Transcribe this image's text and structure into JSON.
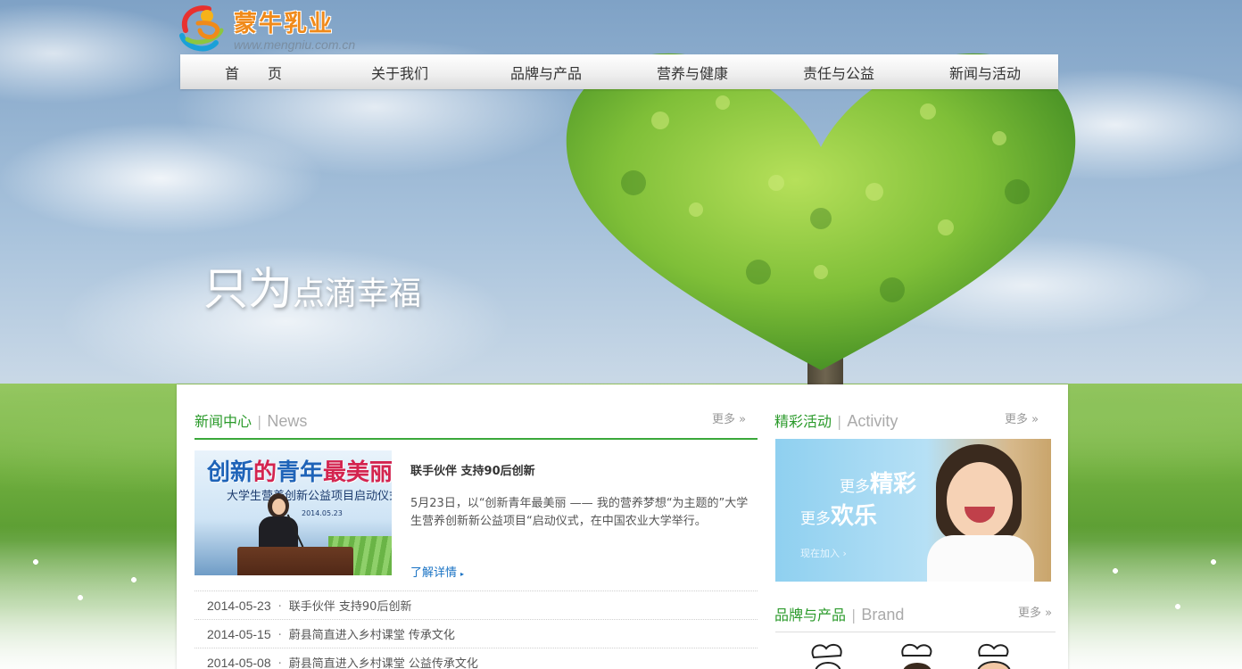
{
  "logo": {
    "name": "蒙牛乳业",
    "url": "www.mengniu.com.cn"
  },
  "nav": {
    "items": [
      "首　　页",
      "关于我们",
      "品牌与产品",
      "营养与健康",
      "责任与公益",
      "新闻与活动"
    ]
  },
  "hero": {
    "slogan_big": "只为",
    "slogan_small": "点滴幸福"
  },
  "news": {
    "title_cn": "新闻中心",
    "separator": "|",
    "title_en": "News",
    "more": "更多 »",
    "photo": {
      "title_blue1": "创新",
      "title_red1": "的",
      "title_blue2": "青年",
      "title_red2": "最美丽",
      "subtitle": "大学生营养创新公益项目启动仪式",
      "date": "2014.05.23"
    },
    "featured": {
      "title": "联手伙伴 支持90后创新",
      "description": "5月23日，以“创新青年最美丽 —— 我的营养梦想“为主题的”大学生营养创新新公益项目“启动仪式，在中国农业大学举行。",
      "more": "了解详情",
      "more_arrow": "▸"
    },
    "list": [
      {
        "date": "2014-05-23",
        "dot": "·",
        "title": "联手伙伴 支持90后创新"
      },
      {
        "date": "2014-05-15",
        "dot": "·",
        "title": "蔚县简直进入乡村课堂 传承文化"
      },
      {
        "date": "2014-05-08",
        "dot": "·",
        "title": "蔚县简直进入乡村课堂 公益传承文化"
      }
    ]
  },
  "activity": {
    "title_cn": "精彩活动",
    "separator": "|",
    "title_en": "Activity",
    "more": "更多 »",
    "banner": {
      "line1_small": "更多",
      "line1_big": "精彩",
      "line2_small": "更多",
      "line2_big": "欢乐",
      "join": "现在加入 ›"
    }
  },
  "brand": {
    "title_cn": "品牌与产品",
    "separator": "|",
    "title_en": "Brand",
    "more": "更多 »"
  },
  "colors": {
    "accent_green": "#2a9a2a",
    "rule_green": "#3aa83a",
    "link_blue": "#1a73c4",
    "logo_orange": "#f08a1a"
  }
}
